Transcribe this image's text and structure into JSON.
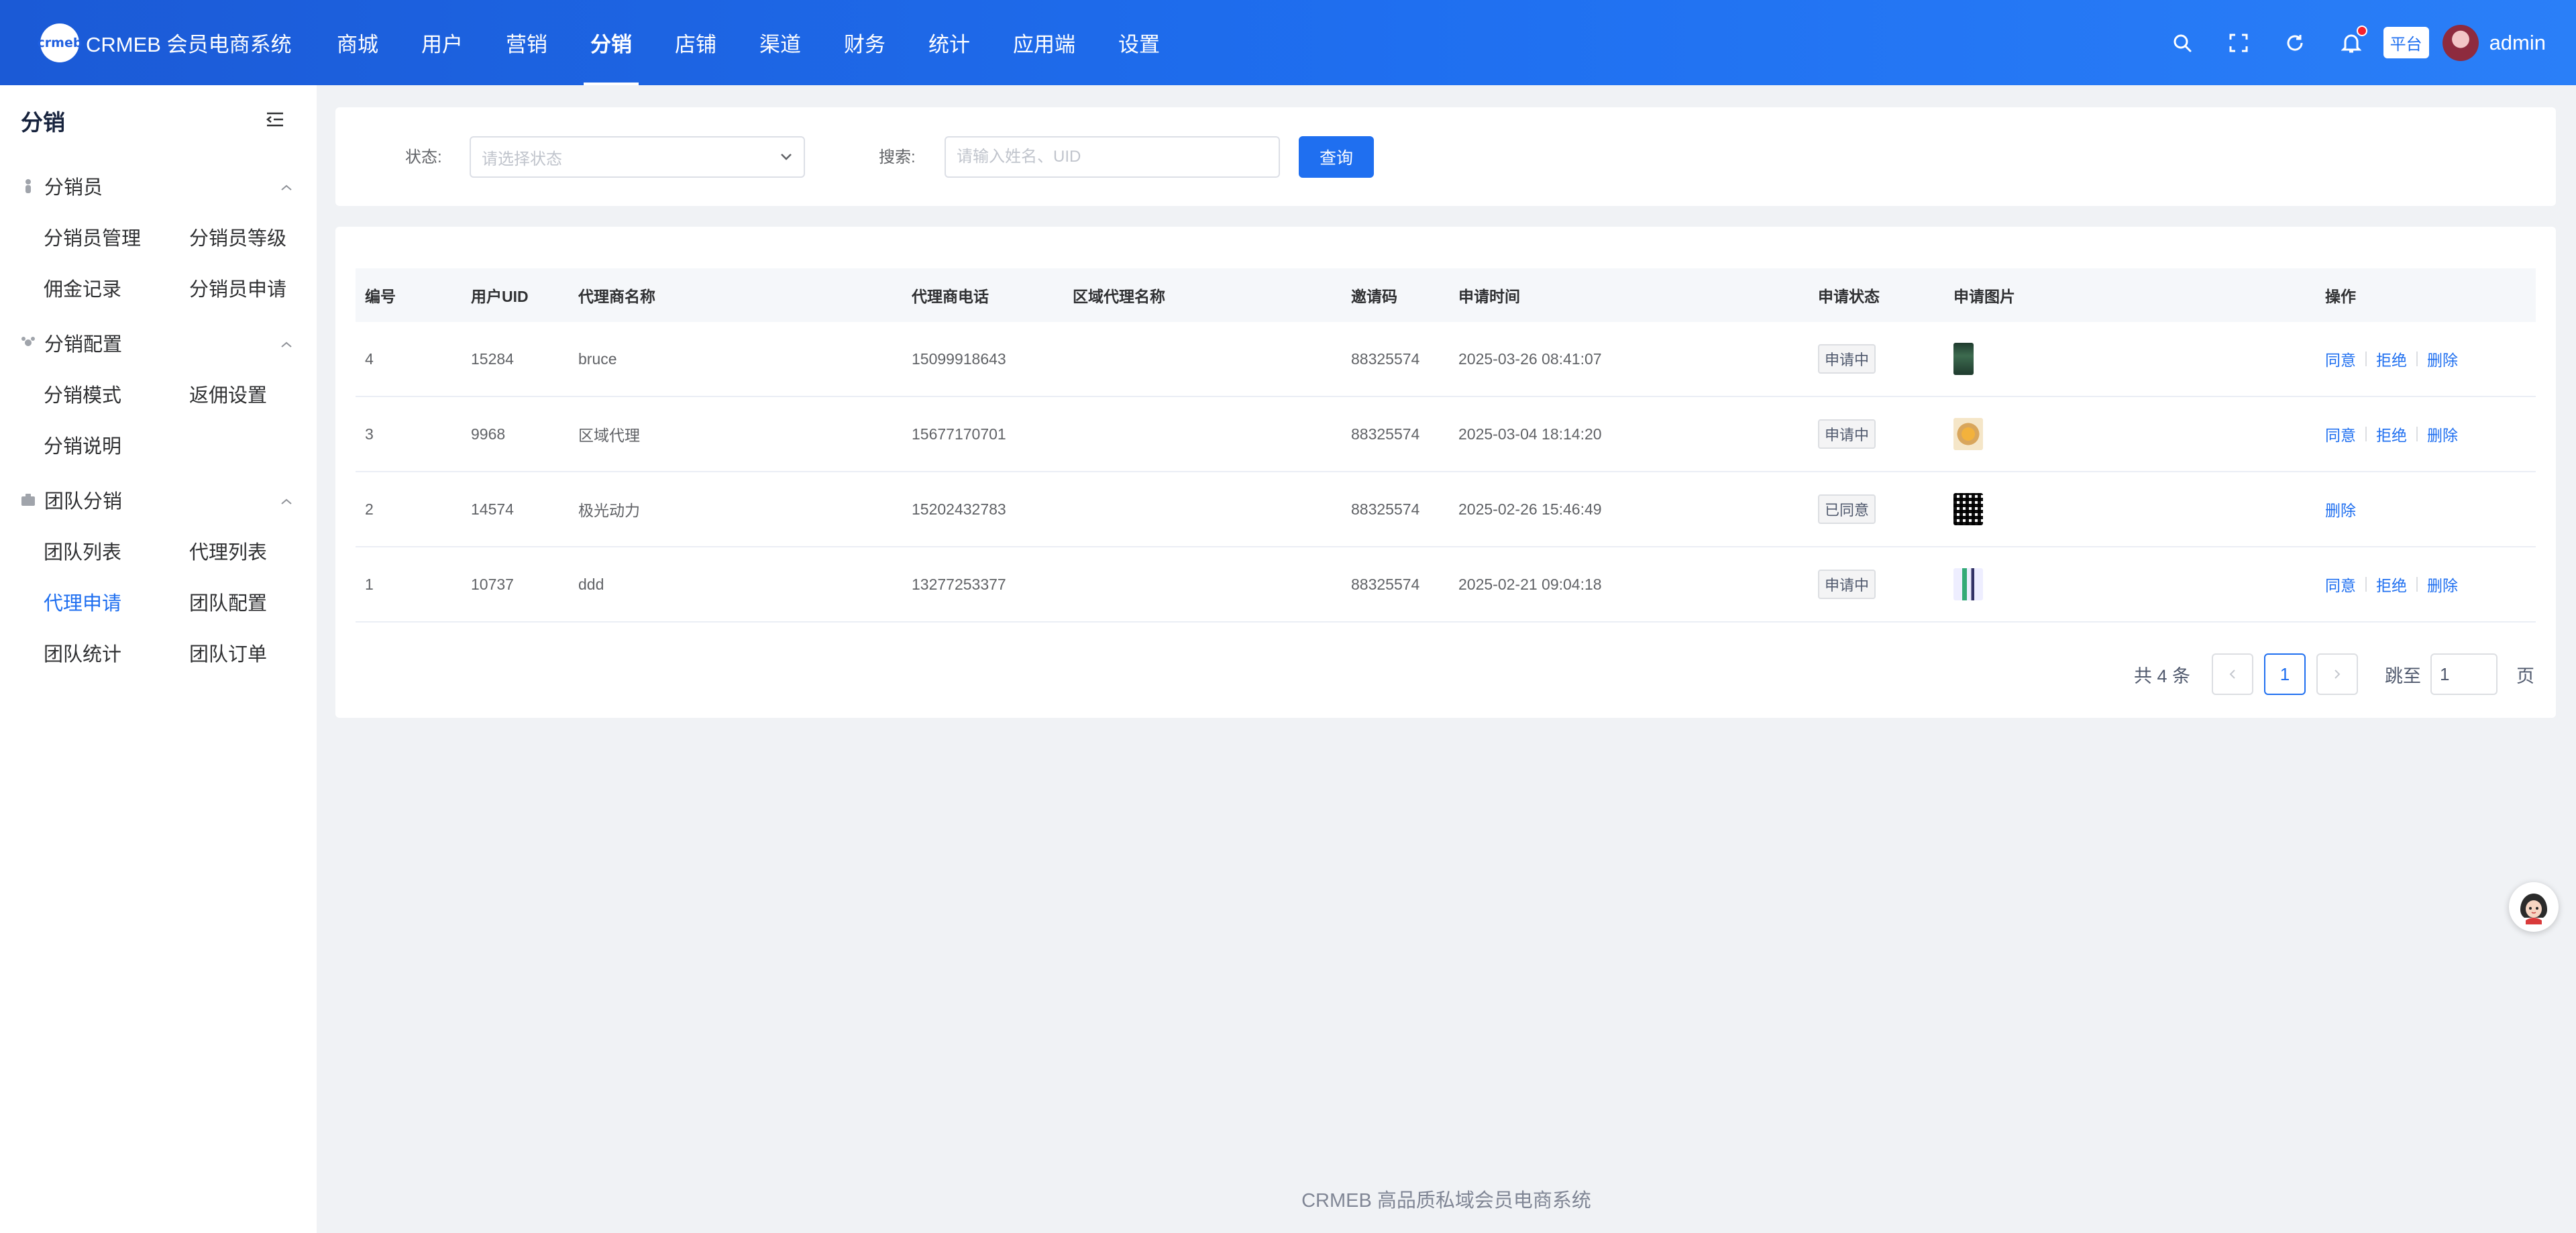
{
  "brand": {
    "logo": "crmeb",
    "title": "CRMEB 会员电商系统"
  },
  "nav": [
    {
      "label": "商城"
    },
    {
      "label": "用户"
    },
    {
      "label": "营销"
    },
    {
      "label": "分销"
    },
    {
      "label": "店铺"
    },
    {
      "label": "渠道"
    },
    {
      "label": "财务"
    },
    {
      "label": "统计"
    },
    {
      "label": "应用端"
    },
    {
      "label": "设置"
    }
  ],
  "nav_active": "分销",
  "topbar": {
    "platform_label": "平台",
    "username": "admin",
    "icons": [
      "search-icon",
      "fullscreen-icon",
      "refresh-icon",
      "bell-icon"
    ]
  },
  "sidebar": {
    "title": "分销",
    "groups": [
      {
        "label": "分销员",
        "icon": "person-icon",
        "items": [
          {
            "label": "分销员管理"
          },
          {
            "label": "分销员等级"
          },
          {
            "label": "佣金记录"
          },
          {
            "label": "分销员申请"
          }
        ]
      },
      {
        "label": "分销配置",
        "icon": "settings-icon",
        "items": [
          {
            "label": "分销模式"
          },
          {
            "label": "返佣设置"
          },
          {
            "label": "分销说明"
          }
        ]
      },
      {
        "label": "团队分销",
        "icon": "team-icon",
        "items": [
          {
            "label": "团队列表"
          },
          {
            "label": "代理列表"
          },
          {
            "label": "代理申请"
          },
          {
            "label": "团队配置"
          },
          {
            "label": "团队统计"
          },
          {
            "label": "团队订单"
          }
        ]
      }
    ],
    "active_item": "代理申请"
  },
  "filter": {
    "status_label": "状态:",
    "status_placeholder": "请选择状态",
    "search_label": "搜索:",
    "search_placeholder": "请输入姓名、UID",
    "query_label": "查询"
  },
  "table": {
    "columns": [
      "编号",
      "用户UID",
      "代理商名称",
      "代理商电话",
      "区域代理名称",
      "邀请码",
      "申请时间",
      "申请状态",
      "申请图片",
      "操作"
    ],
    "rows": [
      {
        "id": "4",
        "uid": "15284",
        "name": "bruce",
        "phone": "15099918643",
        "region": "",
        "invite": "88325574",
        "time": "2025-03-26 08:41:07",
        "status": "申请中",
        "ops": [
          "同意",
          "拒绝",
          "删除"
        ]
      },
      {
        "id": "3",
        "uid": "9968",
        "name": "区域代理",
        "phone": "15677170701",
        "region": "",
        "invite": "88325574",
        "time": "2025-03-04 18:14:20",
        "status": "申请中",
        "ops": [
          "同意",
          "拒绝",
          "删除"
        ]
      },
      {
        "id": "2",
        "uid": "14574",
        "name": "极光动力",
        "phone": "15202432783",
        "region": "",
        "invite": "88325574",
        "time": "2025-02-26 15:46:49",
        "status": "已同意",
        "ops": [
          "删除"
        ]
      },
      {
        "id": "1",
        "uid": "10737",
        "name": "ddd",
        "phone": "13277253377",
        "region": "",
        "invite": "88325574",
        "time": "2025-02-21 09:04:18",
        "status": "申请中",
        "ops": [
          "同意",
          "拒绝",
          "删除"
        ]
      }
    ]
  },
  "pagination": {
    "total_text": "共 4 条",
    "prev": "<",
    "current_page": "1",
    "next": ">",
    "jump_label": "跳至",
    "jump_value": "1",
    "page_unit": "页"
  },
  "footer": {
    "text": "CRMEB 高品质私域会员电商系统"
  },
  "colors": {
    "primary": "#1f6ff0",
    "topbar": "#1b5ad6",
    "background": "#f0f2f5"
  }
}
